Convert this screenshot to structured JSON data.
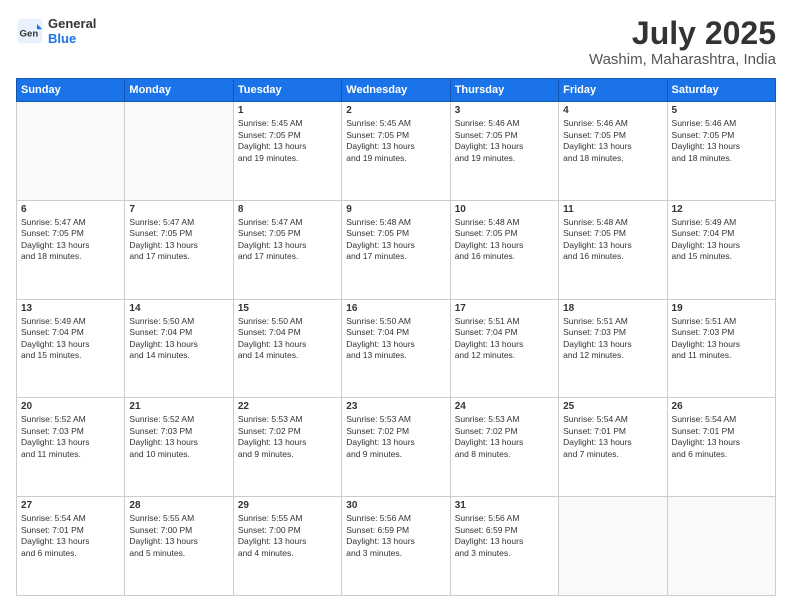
{
  "logo": {
    "general": "General",
    "blue": "Blue"
  },
  "header": {
    "month_year": "July 2025",
    "location": "Washim, Maharashtra, India"
  },
  "days_of_week": [
    "Sunday",
    "Monday",
    "Tuesday",
    "Wednesday",
    "Thursday",
    "Friday",
    "Saturday"
  ],
  "weeks": [
    [
      {
        "day": "",
        "info": ""
      },
      {
        "day": "",
        "info": ""
      },
      {
        "day": "1",
        "info": "Sunrise: 5:45 AM\nSunset: 7:05 PM\nDaylight: 13 hours\nand 19 minutes."
      },
      {
        "day": "2",
        "info": "Sunrise: 5:45 AM\nSunset: 7:05 PM\nDaylight: 13 hours\nand 19 minutes."
      },
      {
        "day": "3",
        "info": "Sunrise: 5:46 AM\nSunset: 7:05 PM\nDaylight: 13 hours\nand 19 minutes."
      },
      {
        "day": "4",
        "info": "Sunrise: 5:46 AM\nSunset: 7:05 PM\nDaylight: 13 hours\nand 18 minutes."
      },
      {
        "day": "5",
        "info": "Sunrise: 5:46 AM\nSunset: 7:05 PM\nDaylight: 13 hours\nand 18 minutes."
      }
    ],
    [
      {
        "day": "6",
        "info": "Sunrise: 5:47 AM\nSunset: 7:05 PM\nDaylight: 13 hours\nand 18 minutes."
      },
      {
        "day": "7",
        "info": "Sunrise: 5:47 AM\nSunset: 7:05 PM\nDaylight: 13 hours\nand 17 minutes."
      },
      {
        "day": "8",
        "info": "Sunrise: 5:47 AM\nSunset: 7:05 PM\nDaylight: 13 hours\nand 17 minutes."
      },
      {
        "day": "9",
        "info": "Sunrise: 5:48 AM\nSunset: 7:05 PM\nDaylight: 13 hours\nand 17 minutes."
      },
      {
        "day": "10",
        "info": "Sunrise: 5:48 AM\nSunset: 7:05 PM\nDaylight: 13 hours\nand 16 minutes."
      },
      {
        "day": "11",
        "info": "Sunrise: 5:48 AM\nSunset: 7:05 PM\nDaylight: 13 hours\nand 16 minutes."
      },
      {
        "day": "12",
        "info": "Sunrise: 5:49 AM\nSunset: 7:04 PM\nDaylight: 13 hours\nand 15 minutes."
      }
    ],
    [
      {
        "day": "13",
        "info": "Sunrise: 5:49 AM\nSunset: 7:04 PM\nDaylight: 13 hours\nand 15 minutes."
      },
      {
        "day": "14",
        "info": "Sunrise: 5:50 AM\nSunset: 7:04 PM\nDaylight: 13 hours\nand 14 minutes."
      },
      {
        "day": "15",
        "info": "Sunrise: 5:50 AM\nSunset: 7:04 PM\nDaylight: 13 hours\nand 14 minutes."
      },
      {
        "day": "16",
        "info": "Sunrise: 5:50 AM\nSunset: 7:04 PM\nDaylight: 13 hours\nand 13 minutes."
      },
      {
        "day": "17",
        "info": "Sunrise: 5:51 AM\nSunset: 7:04 PM\nDaylight: 13 hours\nand 12 minutes."
      },
      {
        "day": "18",
        "info": "Sunrise: 5:51 AM\nSunset: 7:03 PM\nDaylight: 13 hours\nand 12 minutes."
      },
      {
        "day": "19",
        "info": "Sunrise: 5:51 AM\nSunset: 7:03 PM\nDaylight: 13 hours\nand 11 minutes."
      }
    ],
    [
      {
        "day": "20",
        "info": "Sunrise: 5:52 AM\nSunset: 7:03 PM\nDaylight: 13 hours\nand 11 minutes."
      },
      {
        "day": "21",
        "info": "Sunrise: 5:52 AM\nSunset: 7:03 PM\nDaylight: 13 hours\nand 10 minutes."
      },
      {
        "day": "22",
        "info": "Sunrise: 5:53 AM\nSunset: 7:02 PM\nDaylight: 13 hours\nand 9 minutes."
      },
      {
        "day": "23",
        "info": "Sunrise: 5:53 AM\nSunset: 7:02 PM\nDaylight: 13 hours\nand 9 minutes."
      },
      {
        "day": "24",
        "info": "Sunrise: 5:53 AM\nSunset: 7:02 PM\nDaylight: 13 hours\nand 8 minutes."
      },
      {
        "day": "25",
        "info": "Sunrise: 5:54 AM\nSunset: 7:01 PM\nDaylight: 13 hours\nand 7 minutes."
      },
      {
        "day": "26",
        "info": "Sunrise: 5:54 AM\nSunset: 7:01 PM\nDaylight: 13 hours\nand 6 minutes."
      }
    ],
    [
      {
        "day": "27",
        "info": "Sunrise: 5:54 AM\nSunset: 7:01 PM\nDaylight: 13 hours\nand 6 minutes."
      },
      {
        "day": "28",
        "info": "Sunrise: 5:55 AM\nSunset: 7:00 PM\nDaylight: 13 hours\nand 5 minutes."
      },
      {
        "day": "29",
        "info": "Sunrise: 5:55 AM\nSunset: 7:00 PM\nDaylight: 13 hours\nand 4 minutes."
      },
      {
        "day": "30",
        "info": "Sunrise: 5:56 AM\nSunset: 6:59 PM\nDaylight: 13 hours\nand 3 minutes."
      },
      {
        "day": "31",
        "info": "Sunrise: 5:56 AM\nSunset: 6:59 PM\nDaylight: 13 hours\nand 3 minutes."
      },
      {
        "day": "",
        "info": ""
      },
      {
        "day": "",
        "info": ""
      }
    ]
  ]
}
